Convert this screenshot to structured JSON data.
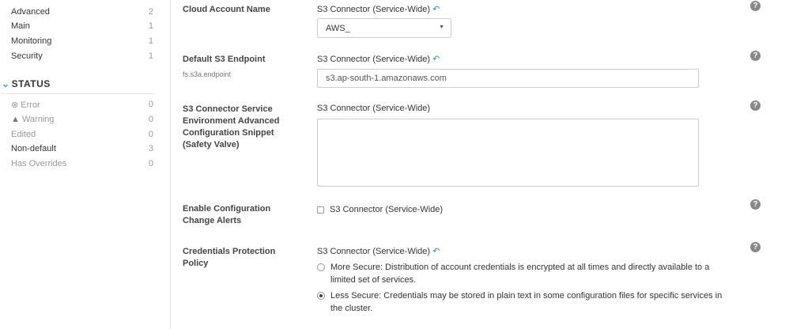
{
  "sidebar": {
    "categories": [
      {
        "label": "Advanced",
        "count": "2"
      },
      {
        "label": "Main",
        "count": "1"
      },
      {
        "label": "Monitoring",
        "count": "1"
      },
      {
        "label": "Security",
        "count": "1"
      }
    ],
    "status_heading": "STATUS",
    "status": [
      {
        "label": "Error",
        "count": "0"
      },
      {
        "label": "Warning",
        "count": "0"
      },
      {
        "label": "Edited",
        "count": "0"
      },
      {
        "label": "Non-default",
        "count": "3"
      },
      {
        "label": "Has Overrides",
        "count": "0"
      }
    ]
  },
  "scope": "S3 Connector (Service-Wide)",
  "help": "?",
  "settings": {
    "cloud_account": {
      "label": "Cloud Account Name",
      "value": "AWS_"
    },
    "endpoint": {
      "label": "Default S3 Endpoint",
      "key": "fs.s3a.endpoint",
      "value": "s3.ap-south-1.amazonaws.com"
    },
    "safety_valve": {
      "label": "S3 Connector Service Environment Advanced Configuration Snippet (Safety Valve)",
      "value": ""
    },
    "alerts": {
      "label": "Enable Configuration Change Alerts",
      "checked": false
    },
    "policy": {
      "label": "Credentials Protection Policy",
      "options": [
        {
          "label": "More Secure: Distribution of account credentials is encrypted at all times and directly available to a limited set of services.",
          "selected": false
        },
        {
          "label": "Less Secure: Credentials may be stored in plain text in some configuration files for specific services in the cluster.",
          "selected": true
        }
      ]
    }
  }
}
